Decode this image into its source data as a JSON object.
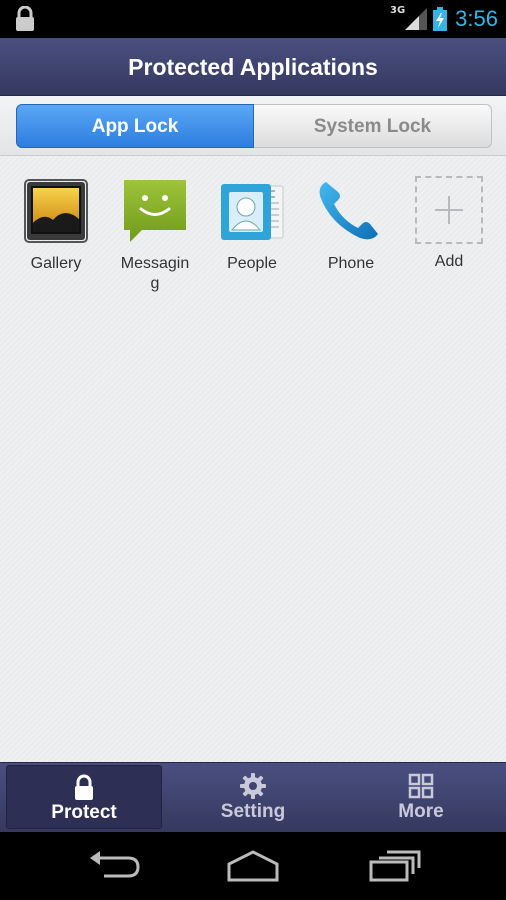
{
  "status_bar": {
    "network": "3G",
    "time": "3:56",
    "icons": [
      "lock-icon",
      "signal-icon",
      "battery-charging-icon"
    ]
  },
  "header": {
    "title": "Protected Applications"
  },
  "segments": {
    "active": "App Lock",
    "inactive": "System Lock"
  },
  "apps": [
    {
      "label": "Gallery",
      "icon": "gallery-icon"
    },
    {
      "label": "Messaging",
      "icon": "messaging-icon"
    },
    {
      "label": "People",
      "icon": "people-icon"
    },
    {
      "label": "Phone",
      "icon": "phone-icon"
    },
    {
      "label": "Add",
      "icon": "add-icon"
    }
  ],
  "tabs": [
    {
      "label": "Protect",
      "icon": "lock-icon",
      "selected": true
    },
    {
      "label": "Setting",
      "icon": "gear-icon",
      "selected": false
    },
    {
      "label": "More",
      "icon": "grid-icon",
      "selected": false
    }
  ],
  "colors": {
    "header": "#3f4470",
    "accent": "#2c7ee0",
    "clock": "#33b5e5"
  }
}
